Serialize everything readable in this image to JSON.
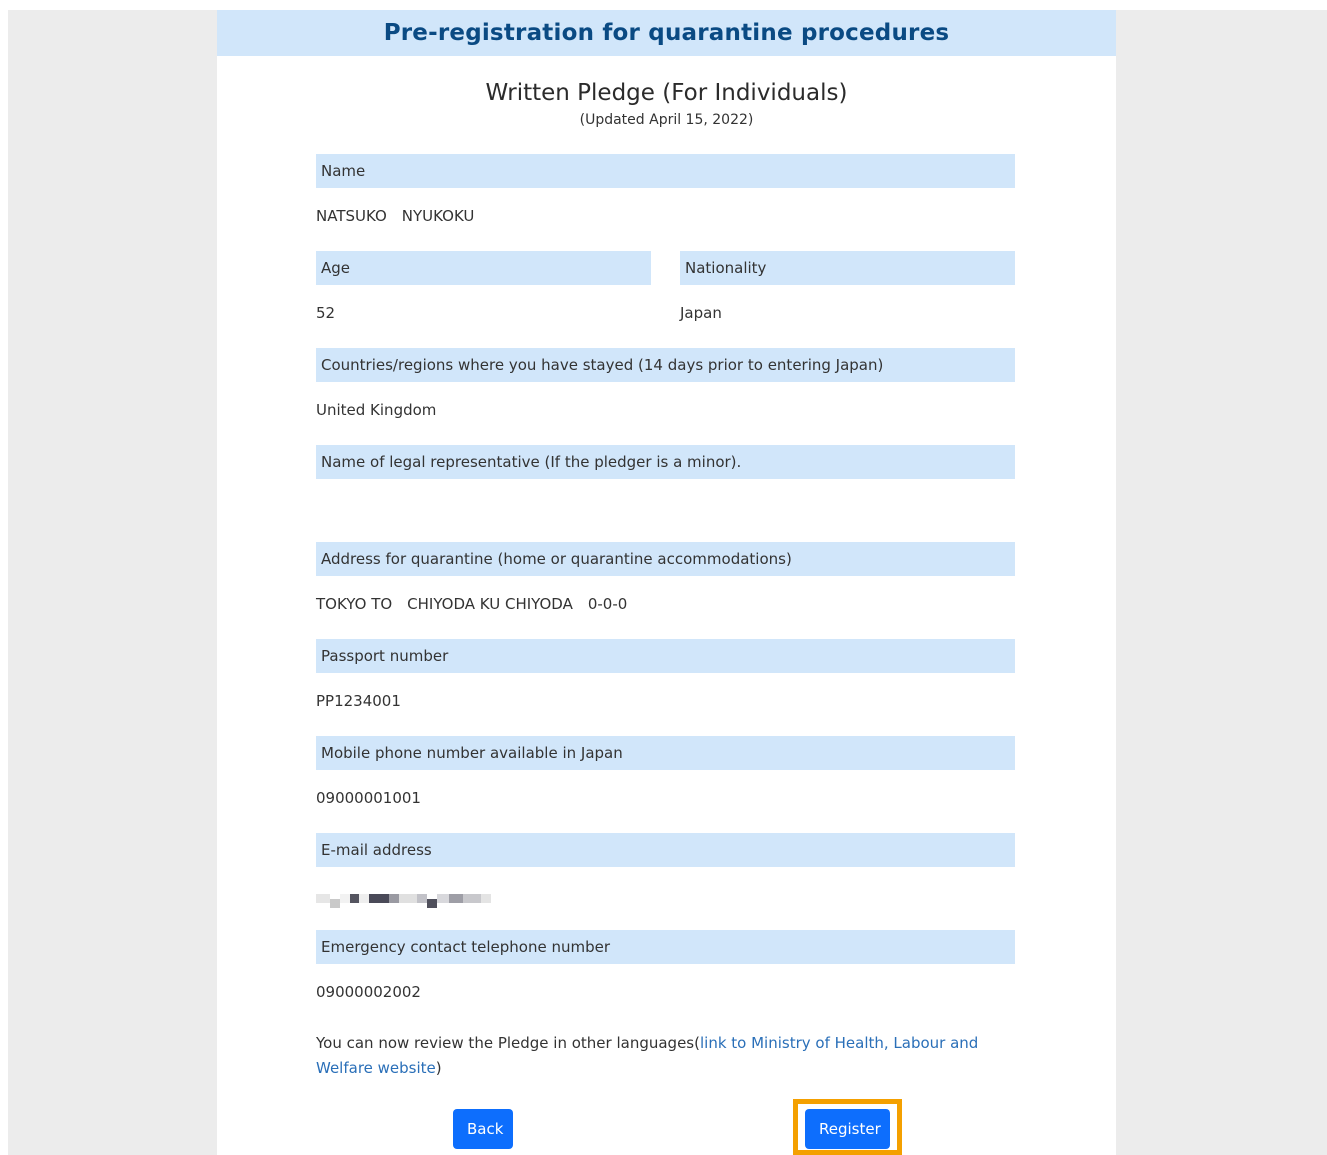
{
  "header": {
    "title": "Pre-registration for quarantine procedures"
  },
  "pledge": {
    "title": "Written Pledge (For Individuals)",
    "updated": "(Updated April 15, 2022)"
  },
  "fields": {
    "name": {
      "label": "Name",
      "value": "NATSUKO　NYUKOKU"
    },
    "age": {
      "label": "Age",
      "value": "52"
    },
    "nationality": {
      "label": "Nationality",
      "value": "Japan"
    },
    "countries": {
      "label": "Countries/regions where you have stayed (14 days prior to entering Japan)",
      "value": "United Kingdom"
    },
    "legal_rep": {
      "label": "Name of legal representative (If the pledger is a minor).",
      "value": ""
    },
    "address": {
      "label": "Address for quarantine (home or quarantine accommodations)",
      "value": "TOKYO TO　CHIYODA KU CHIYODA　0-0-0"
    },
    "passport": {
      "label": "Passport number",
      "value": "PP1234001"
    },
    "mobile": {
      "label": "Mobile phone number available in Japan",
      "value": "09000001001"
    },
    "email": {
      "label": "E-mail address",
      "value": ""
    },
    "emergency": {
      "label": "Emergency contact telephone number",
      "value": "09000002002"
    }
  },
  "note": {
    "text_before": "You can now review the Pledge in other languages(",
    "link_text": "link to Ministry of Health, Labour and Welfare website",
    "text_after": ")"
  },
  "buttons": {
    "back_label": "Back",
    "register_label": "Register"
  },
  "colors": {
    "title_bar_bg": "#d1e6fa",
    "title_text": "#0a4a83",
    "button_bg": "#0d6efd",
    "highlight": "#f4a000",
    "link": "#2a6fb8"
  }
}
